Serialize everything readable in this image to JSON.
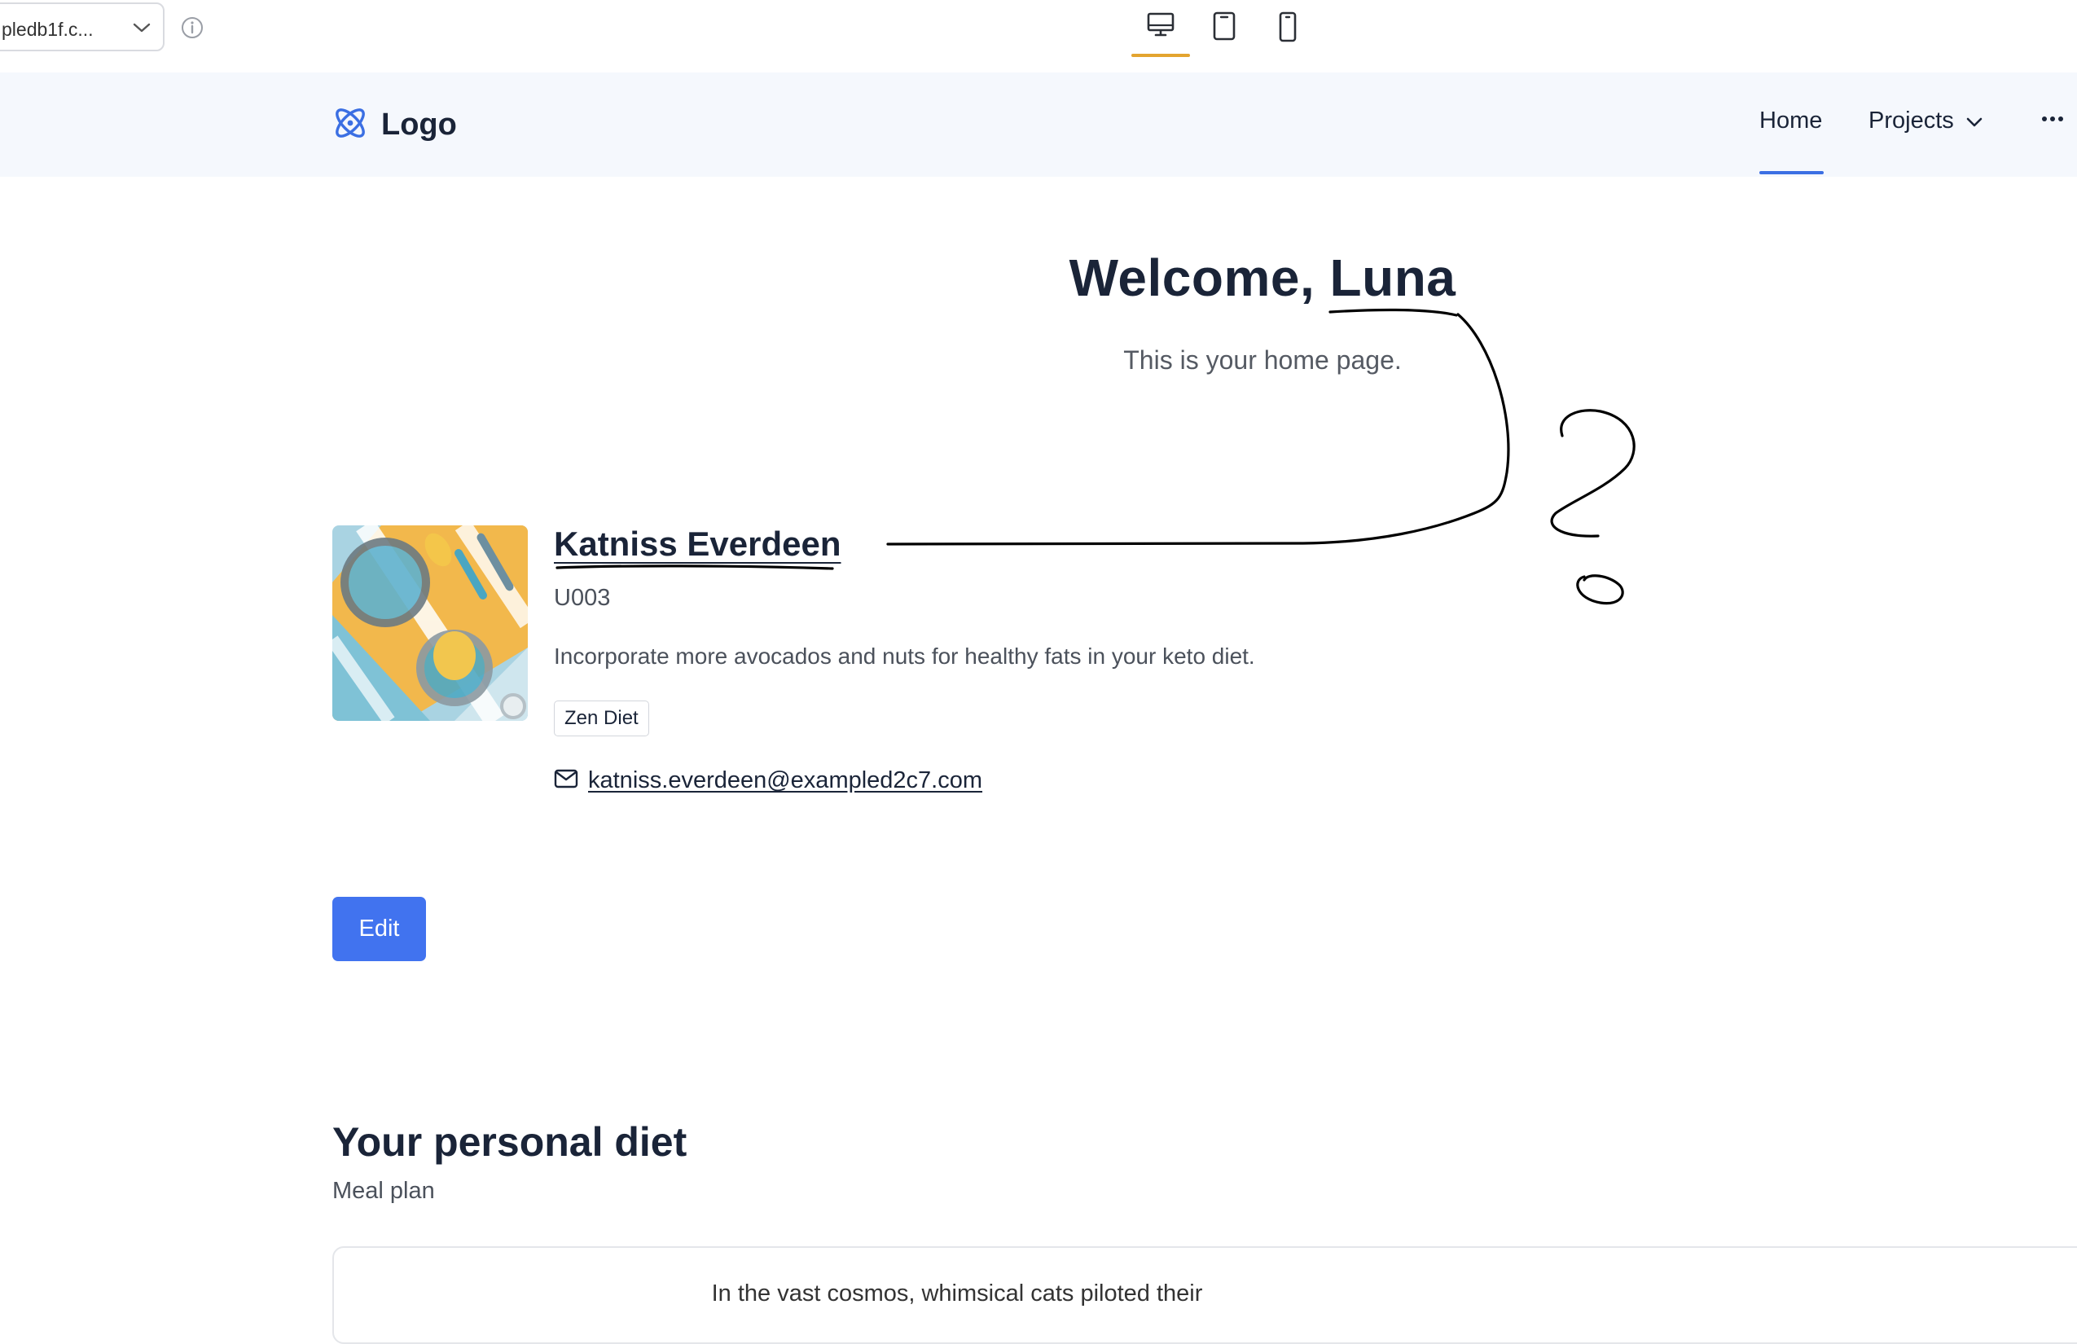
{
  "toolbar": {
    "url_text": "pledb1f.c...",
    "devices": [
      "desktop-icon",
      "tablet-icon",
      "mobile-icon"
    ],
    "active_device": "desktop",
    "accent_color": "#e3a42f"
  },
  "navbar": {
    "logo_text": "Logo",
    "items": [
      {
        "label": "Home",
        "active": true
      },
      {
        "label": "Projects",
        "has_dropdown": true
      }
    ],
    "more_icon": "more-horizontal-icon",
    "accent_color": "#3b6fe3"
  },
  "hero": {
    "title": "Welcome, Luna",
    "subtitle": "This is your home page."
  },
  "profile": {
    "name": "Katniss Everdeen",
    "id": "U003",
    "description": "Incorporate more avocados and nuts for healthy fats in your keto diet.",
    "tag": "Zen Diet",
    "email": "katniss.everdeen@exampled2c7.com",
    "edit_label": "Edit",
    "edit_color": "#4173ef"
  },
  "diet": {
    "title": "Your personal diet",
    "subtitle": "Meal plan",
    "card_text": "In the vast cosmos, whimsical cats piloted their"
  }
}
